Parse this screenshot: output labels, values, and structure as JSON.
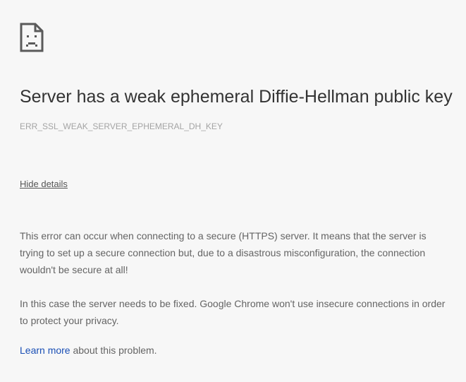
{
  "icon": "sad-page-icon",
  "colors": {
    "background": "#f7f7f7",
    "title": "#333333",
    "body_text": "#646464",
    "error_code": "#a4a4a4",
    "link": "#1a4fb5"
  },
  "error": {
    "title": "Server has a weak ephemeral Diffie-Hellman public key",
    "code": "ERR_SSL_WEAK_SERVER_EPHEMERAL_DH_KEY"
  },
  "details": {
    "toggle_label": "Hide details",
    "paragraph1": "This error can occur when connecting to a secure (HTTPS) server. It means that the server is trying to set up a secure connection but, due to a disastrous misconfiguration, the connection wouldn't be secure at all!",
    "paragraph2": "In this case the server needs to be fixed. Google Chrome won't use insecure connections in order to protect your privacy.",
    "learn_more_link": "Learn more",
    "learn_more_suffix": " about this problem."
  }
}
